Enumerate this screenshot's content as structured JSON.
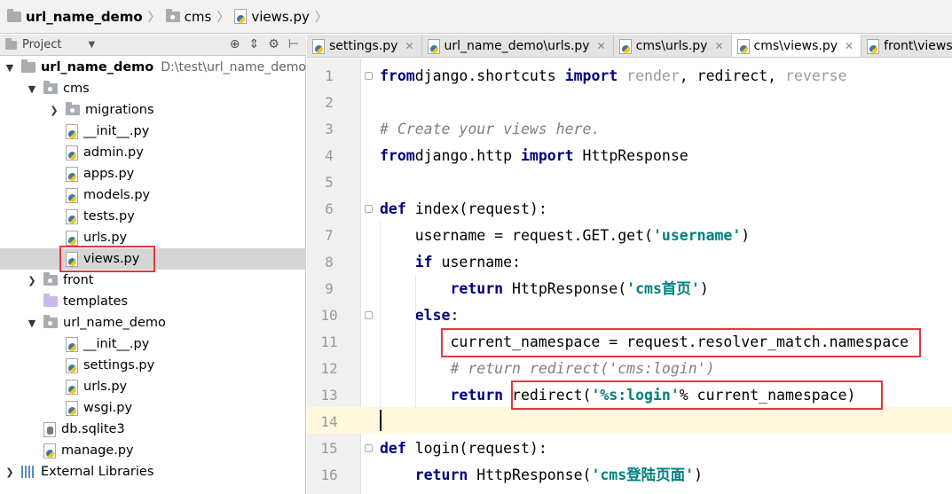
{
  "breadcrumb": [
    "url_name_demo",
    "cms",
    "views.py"
  ],
  "project_panel": {
    "title": "Project",
    "tree": [
      {
        "label": "url_name_demo",
        "path": "D:\\test\\url_name_demo",
        "kind": "folder",
        "expanded": true,
        "bold": true
      },
      {
        "label": "cms",
        "kind": "package",
        "expanded": true
      },
      {
        "label": "migrations",
        "kind": "package",
        "expanded": false
      },
      {
        "label": "__init__.py",
        "kind": "py"
      },
      {
        "label": "admin.py",
        "kind": "py"
      },
      {
        "label": "apps.py",
        "kind": "py"
      },
      {
        "label": "models.py",
        "kind": "py"
      },
      {
        "label": "tests.py",
        "kind": "py"
      },
      {
        "label": "urls.py",
        "kind": "py"
      },
      {
        "label": "views.py",
        "kind": "py",
        "selected": true
      },
      {
        "label": "front",
        "kind": "package",
        "expanded": false
      },
      {
        "label": "templates",
        "kind": "templates"
      },
      {
        "label": "url_name_demo",
        "kind": "package",
        "expanded": true
      },
      {
        "label": "__init__.py",
        "kind": "py"
      },
      {
        "label": "settings.py",
        "kind": "py"
      },
      {
        "label": "urls.py",
        "kind": "py"
      },
      {
        "label": "wsgi.py",
        "kind": "py"
      },
      {
        "label": "db.sqlite3",
        "kind": "db"
      },
      {
        "label": "manage.py",
        "kind": "py"
      },
      {
        "label": "External Libraries",
        "kind": "libs",
        "expanded": false
      }
    ]
  },
  "tabs": [
    {
      "label": "settings.py",
      "active": false
    },
    {
      "label": "url_name_demo\\urls.py",
      "active": false
    },
    {
      "label": "cms\\urls.py",
      "active": false
    },
    {
      "label": "cms\\views.py",
      "active": true
    },
    {
      "label": "front\\views",
      "active": false
    }
  ],
  "editor": {
    "line_numbers": [
      "1",
      "2",
      "3",
      "4",
      "5",
      "6",
      "7",
      "8",
      "9",
      "10",
      "11",
      "12",
      "13",
      "14",
      "15",
      "16"
    ],
    "lines": [
      [
        [
          "kw",
          "from"
        ],
        [
          "",
          "django.shortcuts "
        ],
        [
          "kw",
          "import"
        ],
        [
          "unused",
          " render"
        ],
        [
          "",
          ", redirect, "
        ],
        [
          "unused",
          "reverse"
        ]
      ],
      [],
      [
        [
          "cm",
          "# Create your views here."
        ]
      ],
      [
        [
          "kw",
          "from"
        ],
        [
          "",
          "django.http "
        ],
        [
          "kw",
          "import"
        ],
        [
          "",
          " HttpResponse"
        ]
      ],
      [],
      [
        [
          "kw",
          "def"
        ],
        [
          "",
          " index(request):"
        ]
      ],
      [
        [
          "",
          "    username = request.GET.get("
        ],
        [
          "str",
          "'username'"
        ],
        [
          "",
          ")"
        ]
      ],
      [
        [
          "",
          "    "
        ],
        [
          "kw",
          "if"
        ],
        [
          "",
          " username:"
        ]
      ],
      [
        [
          "",
          "        "
        ],
        [
          "kw",
          "return"
        ],
        [
          "",
          " HttpResponse("
        ],
        [
          "str",
          "'cms首页'"
        ],
        [
          "",
          ")"
        ]
      ],
      [
        [
          "",
          "    "
        ],
        [
          "kw",
          "else"
        ],
        [
          "",
          ":"
        ]
      ],
      [
        [
          "",
          "        current_namespace = request.resolver_match.namespace"
        ]
      ],
      [
        [
          "",
          "        "
        ],
        [
          "cm",
          "# return redirect('cms:login')"
        ]
      ],
      [
        [
          "",
          "        "
        ],
        [
          "kw",
          "return"
        ],
        [
          "",
          " redirect("
        ],
        [
          "str",
          "'%s:login'"
        ],
        [
          "",
          "% current_namespace)"
        ]
      ],
      [],
      [
        [
          "kw",
          "def"
        ],
        [
          "",
          " login(request):"
        ]
      ],
      [
        [
          "",
          "    "
        ],
        [
          "kw",
          "return"
        ],
        [
          "",
          " HttpResponse("
        ],
        [
          "str",
          "'cms登陆页面'"
        ],
        [
          "",
          ")"
        ]
      ]
    ]
  },
  "colors": {
    "keyword": "#000080",
    "string": "#008080",
    "comment": "#808080",
    "highlight": "#e0393e"
  }
}
